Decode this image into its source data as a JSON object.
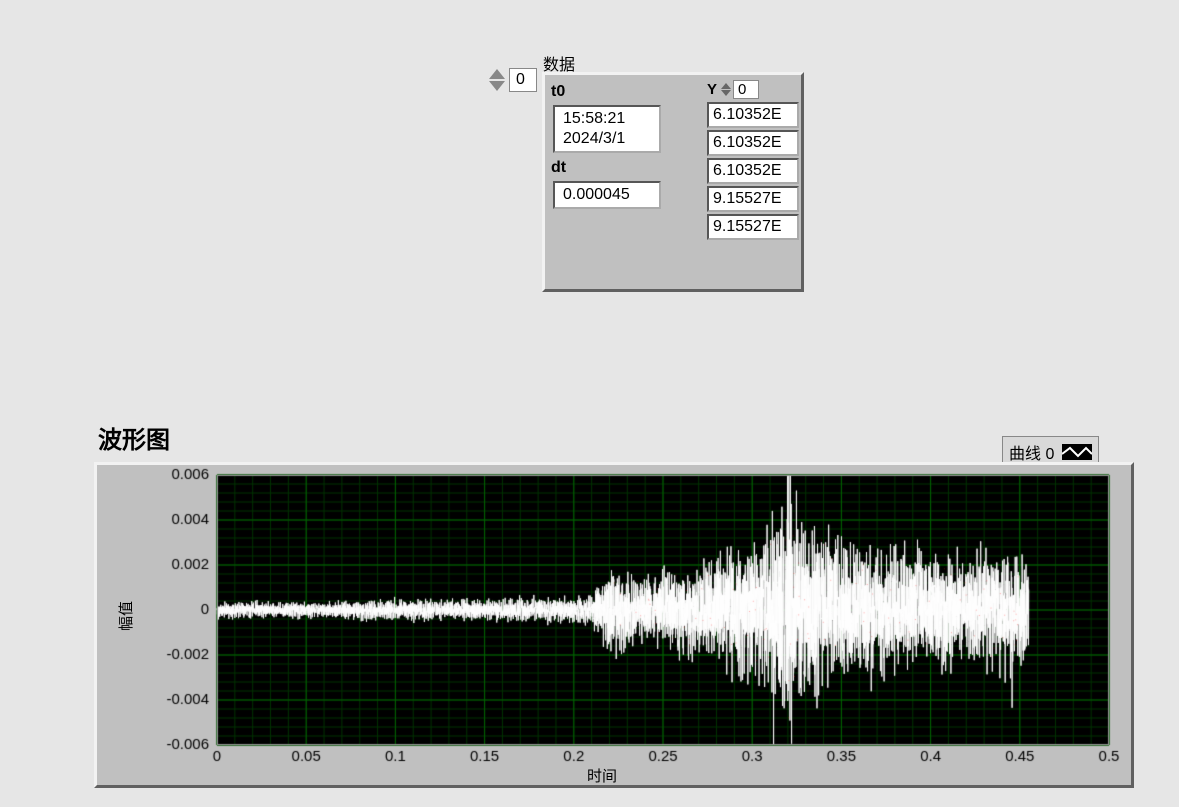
{
  "cluster": {
    "data_label": "数据",
    "index": "0",
    "t0_label": "t0",
    "t0_time": "15:58:21",
    "t0_date": "2024/3/1",
    "dt_label": "dt",
    "dt_value": "0.000045",
    "Y_label": "Y",
    "Y_index": "0",
    "Y_values": [
      "6.10352E",
      "6.10352E",
      "6.10352E",
      "9.15527E",
      "9.15527E"
    ]
  },
  "graph": {
    "title": "波形图",
    "legend": "曲线 0",
    "xlabel": "时间",
    "ylabel": "幅值"
  },
  "chart_data": {
    "type": "line",
    "xlabel": "时间",
    "ylabel": "幅值",
    "xlim": [
      0,
      0.5
    ],
    "ylim": [
      -0.006,
      0.006
    ],
    "x_ticks": [
      0,
      0.05,
      0.1,
      0.15,
      0.2,
      0.25,
      0.3,
      0.35,
      0.4,
      0.45,
      0.5
    ],
    "y_ticks": [
      -0.006,
      -0.004,
      -0.002,
      0,
      0.002,
      0.004,
      0.006
    ],
    "dt": 4.5e-05,
    "series": [
      {
        "name": "曲线 0",
        "envelope": [
          {
            "x": 0.0,
            "amp": 0.0003
          },
          {
            "x": 0.05,
            "amp": 0.0003
          },
          {
            "x": 0.1,
            "amp": 0.0004
          },
          {
            "x": 0.15,
            "amp": 0.0004
          },
          {
            "x": 0.2,
            "amp": 0.0005
          },
          {
            "x": 0.21,
            "amp": 0.0006
          },
          {
            "x": 0.22,
            "amp": 0.0015
          },
          {
            "x": 0.24,
            "amp": 0.0013
          },
          {
            "x": 0.26,
            "amp": 0.0016
          },
          {
            "x": 0.28,
            "amp": 0.002
          },
          {
            "x": 0.3,
            "amp": 0.0028
          },
          {
            "x": 0.31,
            "amp": 0.003
          },
          {
            "x": 0.32,
            "amp": 0.005
          },
          {
            "x": 0.33,
            "amp": 0.0035
          },
          {
            "x": 0.34,
            "amp": 0.003
          },
          {
            "x": 0.36,
            "amp": 0.0024
          },
          {
            "x": 0.38,
            "amp": 0.0022
          },
          {
            "x": 0.4,
            "amp": 0.0022
          },
          {
            "x": 0.42,
            "amp": 0.002
          },
          {
            "x": 0.44,
            "amp": 0.0022
          },
          {
            "x": 0.45,
            "amp": 0.002
          },
          {
            "x": 0.455,
            "amp": 0.002
          }
        ]
      }
    ]
  }
}
